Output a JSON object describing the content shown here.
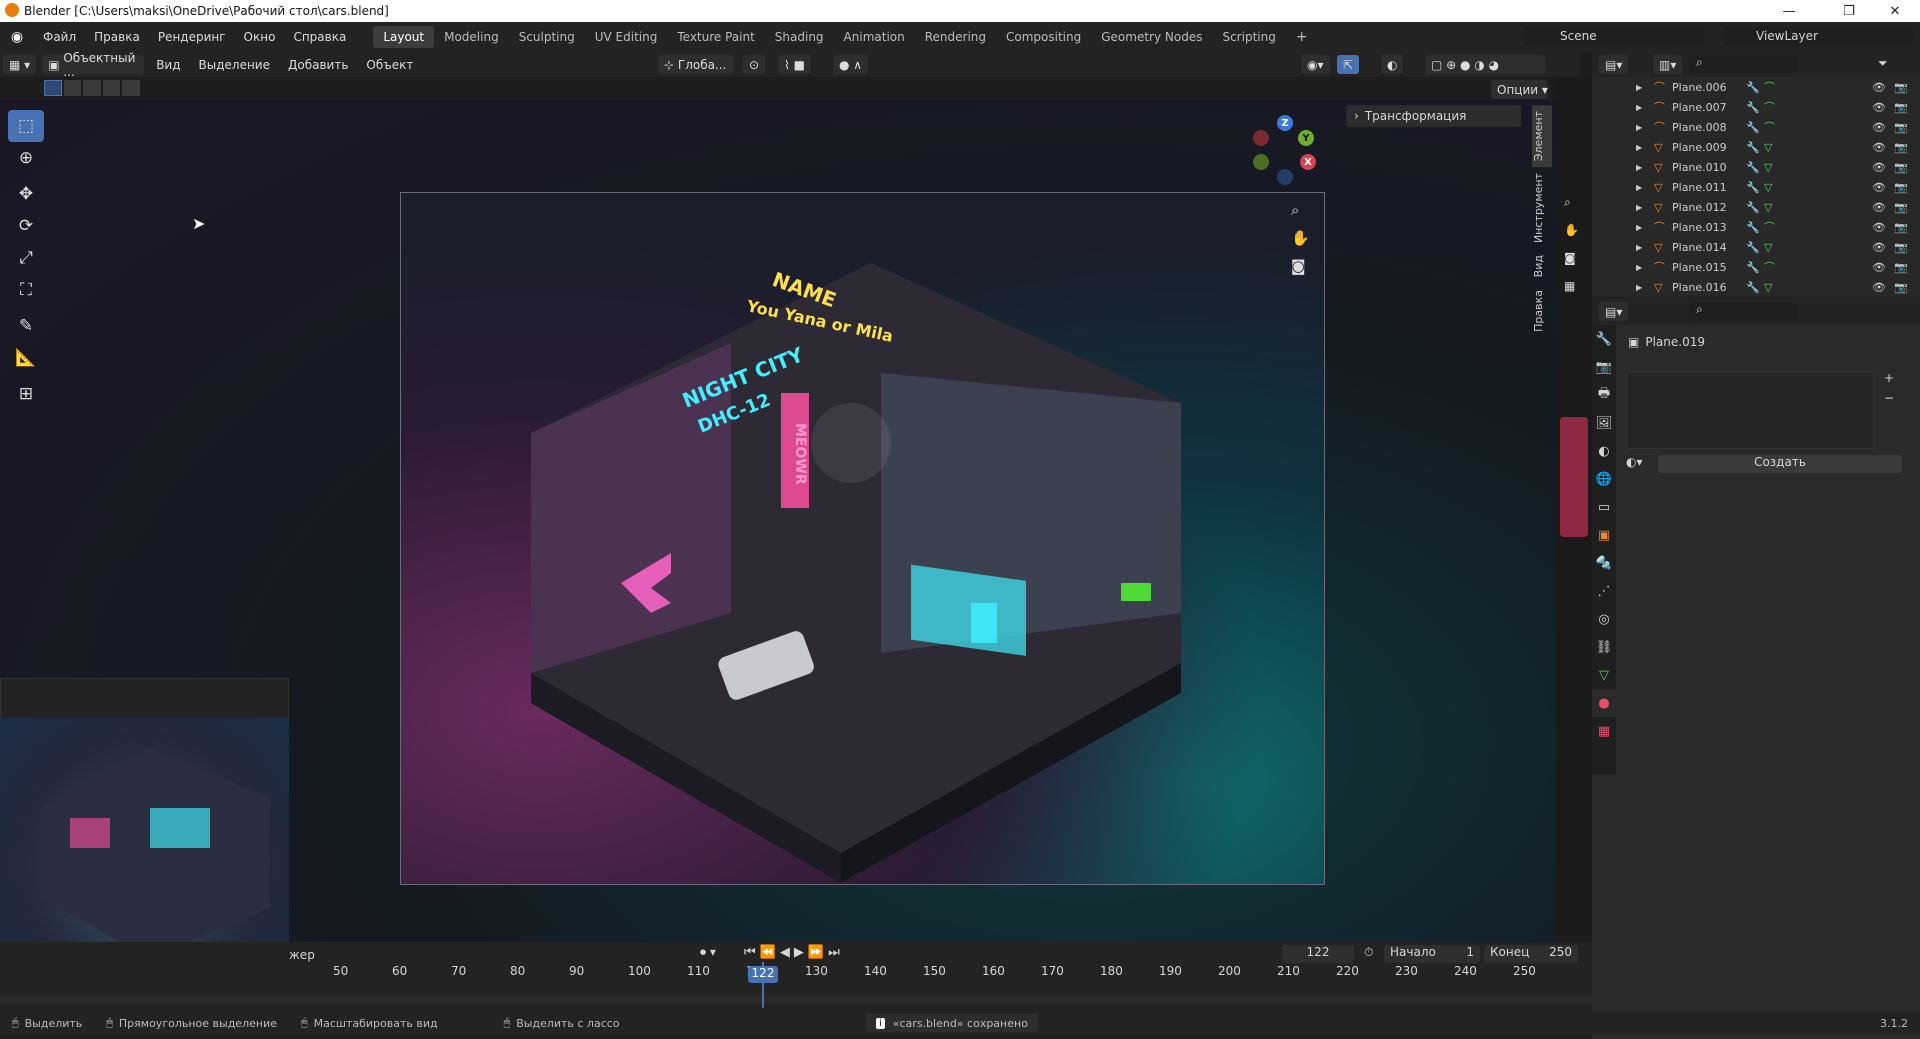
{
  "window": {
    "title": "Blender [C:\\Users\\maksi\\OneDrive\\Рабочий стол\\cars.blend]"
  },
  "menus": [
    "Файл",
    "Правка",
    "Рендеринг",
    "Окно",
    "Справка"
  ],
  "workspaces": [
    "Layout",
    "Modeling",
    "Sculpting",
    "UV Editing",
    "Texture Paint",
    "Shading",
    "Animation",
    "Rendering",
    "Compositing",
    "Geometry Nodes",
    "Scripting"
  ],
  "active_workspace": "Layout",
  "scene": {
    "label": "Scene",
    "view_layer": "ViewLayer"
  },
  "viewport_header": {
    "mode": "Объектный ...",
    "menus": [
      "Вид",
      "Выделение",
      "Добавить",
      "Объект"
    ],
    "orientation": "Глоба...",
    "options": "Опции"
  },
  "npanel": {
    "section": "Трансформация",
    "tabs": [
      "Элемент",
      "Инструмент",
      "Вид",
      "Правка"
    ]
  },
  "outliner": {
    "items": [
      {
        "name": "Plane.006",
        "kind": "curve"
      },
      {
        "name": "Plane.007",
        "kind": "curve"
      },
      {
        "name": "Plane.008",
        "kind": "curve"
      },
      {
        "name": "Plane.009",
        "kind": "mesh"
      },
      {
        "name": "Plane.010",
        "kind": "mesh"
      },
      {
        "name": "Plane.011",
        "kind": "mesh"
      },
      {
        "name": "Plane.012",
        "kind": "mesh"
      },
      {
        "name": "Plane.013",
        "kind": "curve"
      },
      {
        "name": "Plane.014",
        "kind": "mesh"
      },
      {
        "name": "Plane.015",
        "kind": "curve"
      },
      {
        "name": "Plane.016",
        "kind": "mesh"
      }
    ]
  },
  "properties": {
    "object": "Plane.019",
    "create_button": "Создать"
  },
  "timeline": {
    "label": "жер",
    "current_frame": "122",
    "start_label": "Начало",
    "start": "1",
    "end_label": "Конец",
    "end": "250",
    "ticks": [
      "50",
      "60",
      "70",
      "80",
      "90",
      "100",
      "110",
      "1",
      "130",
      "140",
      "150",
      "160",
      "170",
      "180",
      "190",
      "200",
      "210",
      "220",
      "230",
      "240",
      "250"
    ]
  },
  "statusbar": {
    "select": "Выделить",
    "box_select": "Прямоугольное выделение",
    "zoom": "Масштабировать вид",
    "lasso": "Выделить с лассо",
    "message": "«cars.blend» сохранено",
    "version": "3.1.2"
  },
  "scene_art": {
    "sign_name": "NAME",
    "sign_sub": "You Yana or Mila",
    "sign_city": "NIGHT CITY",
    "sign_dhc": "DHC-12",
    "sign_meowr": "MEOWR"
  },
  "colors": {
    "accent": "#4772b3",
    "header": "#232323",
    "pink_neon": "#ff4fa0",
    "cyan_neon": "#3ff0ff"
  }
}
